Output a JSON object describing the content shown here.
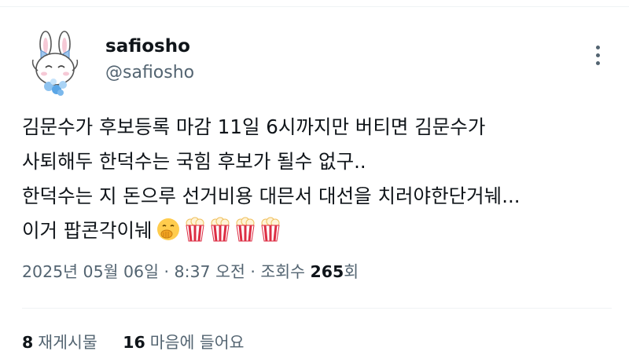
{
  "author": {
    "display_name": "safiosho",
    "handle": "@safiosho",
    "avatar_icon": "bunny-avatar-icon"
  },
  "more_icon": "more-options-icon",
  "tweet": {
    "lines": [
      "김문수가 후보등록 마감 11일 6시까지만 버티면 김문수가",
      "사퇴해두 한덕수는 국힘 후보가 될수 없구..",
      "한덕수는 지 돈으루 선거비용 대믄서 대선을 치러야한단거눼...",
      "이거 팝콘각이눼"
    ],
    "emojis": [
      "face-with-hand-over-mouth-emoji",
      "popcorn-emoji",
      "popcorn-emoji",
      "popcorn-emoji",
      "popcorn-emoji"
    ]
  },
  "meta": {
    "date": "2025년 05월 06일",
    "sep1": " · ",
    "time": "8:37 오전",
    "sep2": " · ",
    "views_label": "조회수 ",
    "views_count": "265",
    "views_suffix": "회"
  },
  "stats": {
    "reposts_count": "8",
    "reposts_label": "재게시물",
    "likes_count": "16",
    "likes_label": "마음에 들어요"
  },
  "colors": {
    "text": "#0f1419",
    "secondary": "#536471",
    "divider": "#eff3f4"
  }
}
